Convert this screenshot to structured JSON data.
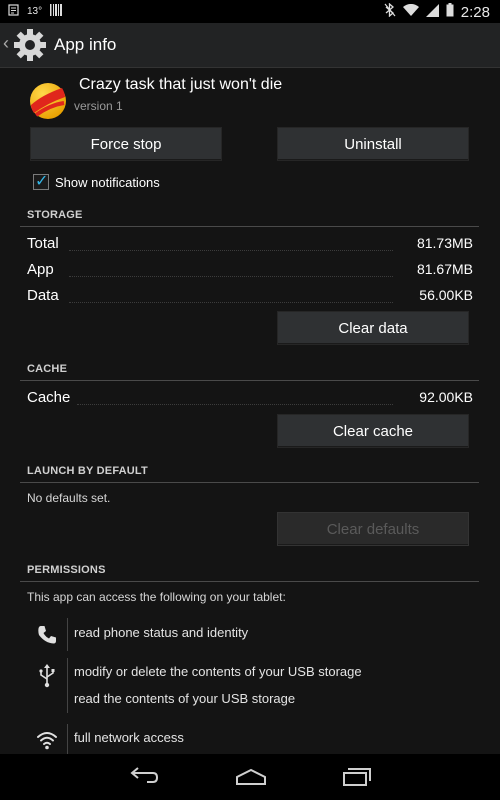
{
  "status_bar": {
    "temperature": "13°",
    "time": "2:28"
  },
  "action_bar": {
    "title": "App info"
  },
  "app": {
    "name": "Crazy task that just won't die",
    "version": "version 1"
  },
  "buttons": {
    "force_stop": "Force stop",
    "uninstall": "Uninstall",
    "clear_data": "Clear data",
    "clear_cache": "Clear cache",
    "clear_defaults": "Clear defaults"
  },
  "notifications": {
    "label": "Show notifications",
    "checked": true
  },
  "storage": {
    "title": "STORAGE",
    "rows": [
      {
        "label": "Total",
        "value": "81.73MB"
      },
      {
        "label": "App",
        "value": "81.67MB"
      },
      {
        "label": "Data",
        "value": "56.00KB"
      }
    ]
  },
  "cache": {
    "title": "CACHE",
    "rows": [
      {
        "label": "Cache",
        "value": "92.00KB"
      }
    ]
  },
  "launch_by_default": {
    "title": "LAUNCH BY DEFAULT",
    "text": "No defaults set."
  },
  "permissions": {
    "title": "PERMISSIONS",
    "intro": "This app can access the following on your tablet:",
    "items": [
      {
        "icon": "phone-icon",
        "lines": [
          "read phone status and identity"
        ]
      },
      {
        "icon": "usb-icon",
        "lines": [
          "modify or delete the contents of your USB storage",
          "read the contents of your USB storage"
        ]
      },
      {
        "icon": "wifi-icon",
        "lines": [
          "full network access"
        ]
      }
    ]
  },
  "colors": {
    "accent": "#33b5e5",
    "background": "#141414",
    "button": "#2f3133"
  }
}
